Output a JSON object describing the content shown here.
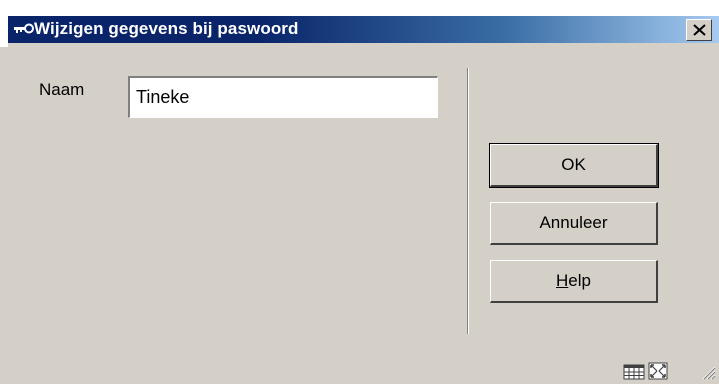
{
  "window": {
    "title": "Wijzigen gegevens bij paswoord"
  },
  "form": {
    "name_label": "Naam",
    "name_value": "Tineke"
  },
  "buttons": {
    "ok": "OK",
    "cancel": "Annuleer",
    "help_prefix": "",
    "help_mnemonic": "H",
    "help_rest": "elp"
  },
  "icons": {
    "app": "key-icon",
    "close": "close-icon",
    "grid": "grid-icon",
    "maximize": "maximize-icon",
    "grip": "resize-grip-icon"
  },
  "colors": {
    "titlebar_start": "#0a246a",
    "titlebar_end": "#a6caf0",
    "face": "#d4d0c8"
  }
}
